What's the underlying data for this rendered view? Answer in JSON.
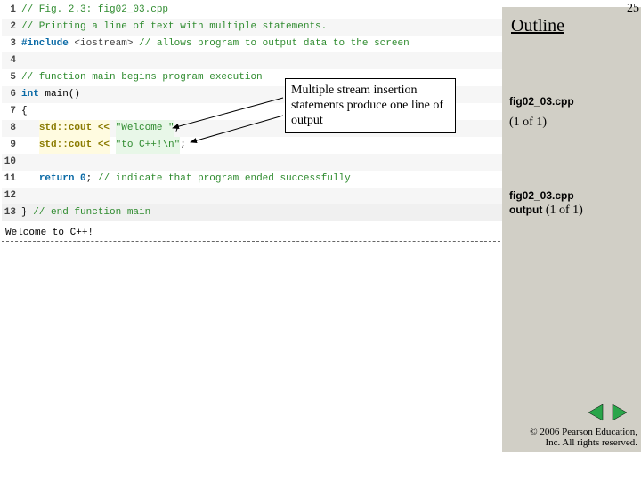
{
  "page_number": "25",
  "outline_title": "Outline",
  "callout_text": "Multiple stream insertion statements produce one line of output",
  "code": [
    {
      "n": "1",
      "cls": "",
      "parts": [
        [
          "cmt",
          "// Fig. 2.3: fig02_03.cpp"
        ]
      ]
    },
    {
      "n": "2",
      "cls": "alt",
      "parts": [
        [
          "cmt",
          "// Printing a line of text with multiple statements."
        ]
      ]
    },
    {
      "n": "3",
      "cls": "",
      "parts": [
        [
          "pp",
          "#include "
        ],
        [
          "ppv",
          "<iostream>"
        ],
        [
          "cmt",
          " // allows program to output data to the screen"
        ]
      ]
    },
    {
      "n": "4",
      "cls": "alt",
      "parts": [
        [
          "",
          ""
        ]
      ]
    },
    {
      "n": "5",
      "cls": "",
      "parts": [
        [
          "cmt",
          "// function main begins program execution"
        ]
      ]
    },
    {
      "n": "6",
      "cls": "alt",
      "parts": [
        [
          "kw",
          "int"
        ],
        [
          "",
          " main()"
        ]
      ]
    },
    {
      "n": "7",
      "cls": "",
      "parts": [
        [
          "",
          "{"
        ]
      ]
    },
    {
      "n": "8",
      "cls": "alt",
      "parts": [
        [
          "",
          "   "
        ],
        [
          "std",
          "std::cout <<"
        ],
        [
          "",
          " "
        ],
        [
          "str",
          "\"Welcome \""
        ],
        [
          "",
          ";"
        ]
      ]
    },
    {
      "n": "9",
      "cls": "",
      "parts": [
        [
          "",
          "   "
        ],
        [
          "std",
          "std::cout <<"
        ],
        [
          "",
          " "
        ],
        [
          "str",
          "\"to C++!\\n\""
        ],
        [
          "",
          ";"
        ]
      ]
    },
    {
      "n": "10",
      "cls": "alt",
      "parts": [
        [
          "",
          ""
        ]
      ]
    },
    {
      "n": "11",
      "cls": "",
      "parts": [
        [
          "",
          "   "
        ],
        [
          "kw",
          "return"
        ],
        [
          "",
          " "
        ],
        [
          "kw",
          "0"
        ],
        [
          "",
          ";"
        ],
        [
          "cmt",
          " // indicate that program ended successfully"
        ]
      ]
    },
    {
      "n": "12",
      "cls": "alt",
      "parts": [
        [
          "",
          ""
        ]
      ]
    },
    {
      "n": "13",
      "cls": "last",
      "parts": [
        [
          "",
          "} "
        ],
        [
          "cmt",
          "// end function main"
        ]
      ]
    }
  ],
  "output_text": "Welcome to C++!",
  "right": {
    "label1": "fig02_03.cpp",
    "sub1": "(1 of 1)",
    "label2a": "fig02_03.cpp",
    "label2b": "output",
    "sub2": " (1 of 1)"
  },
  "copyright": {
    "l1": "© 2006 Pearson Education,",
    "l2": "Inc.  All rights reserved."
  }
}
